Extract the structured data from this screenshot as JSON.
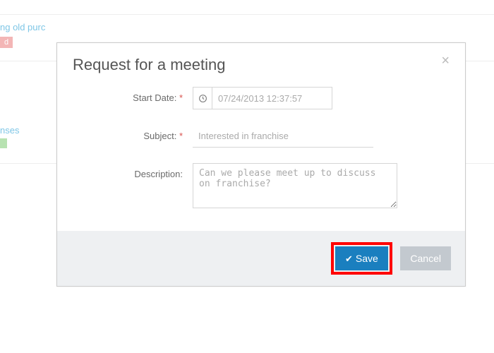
{
  "background": {
    "link1": "ng old purc",
    "link2": "nses"
  },
  "modal": {
    "title": "Request for a meeting",
    "fields": {
      "startDate": {
        "label": "Start Date:",
        "value": "07/24/2013 12:37:57"
      },
      "subject": {
        "label": "Subject:",
        "value": "Interested in franchise"
      },
      "description": {
        "label": "Description:",
        "value": "Can we please meet up to discuss on franchise?"
      }
    },
    "required_marker": "*",
    "buttons": {
      "save": "Save",
      "cancel": "Cancel"
    }
  }
}
